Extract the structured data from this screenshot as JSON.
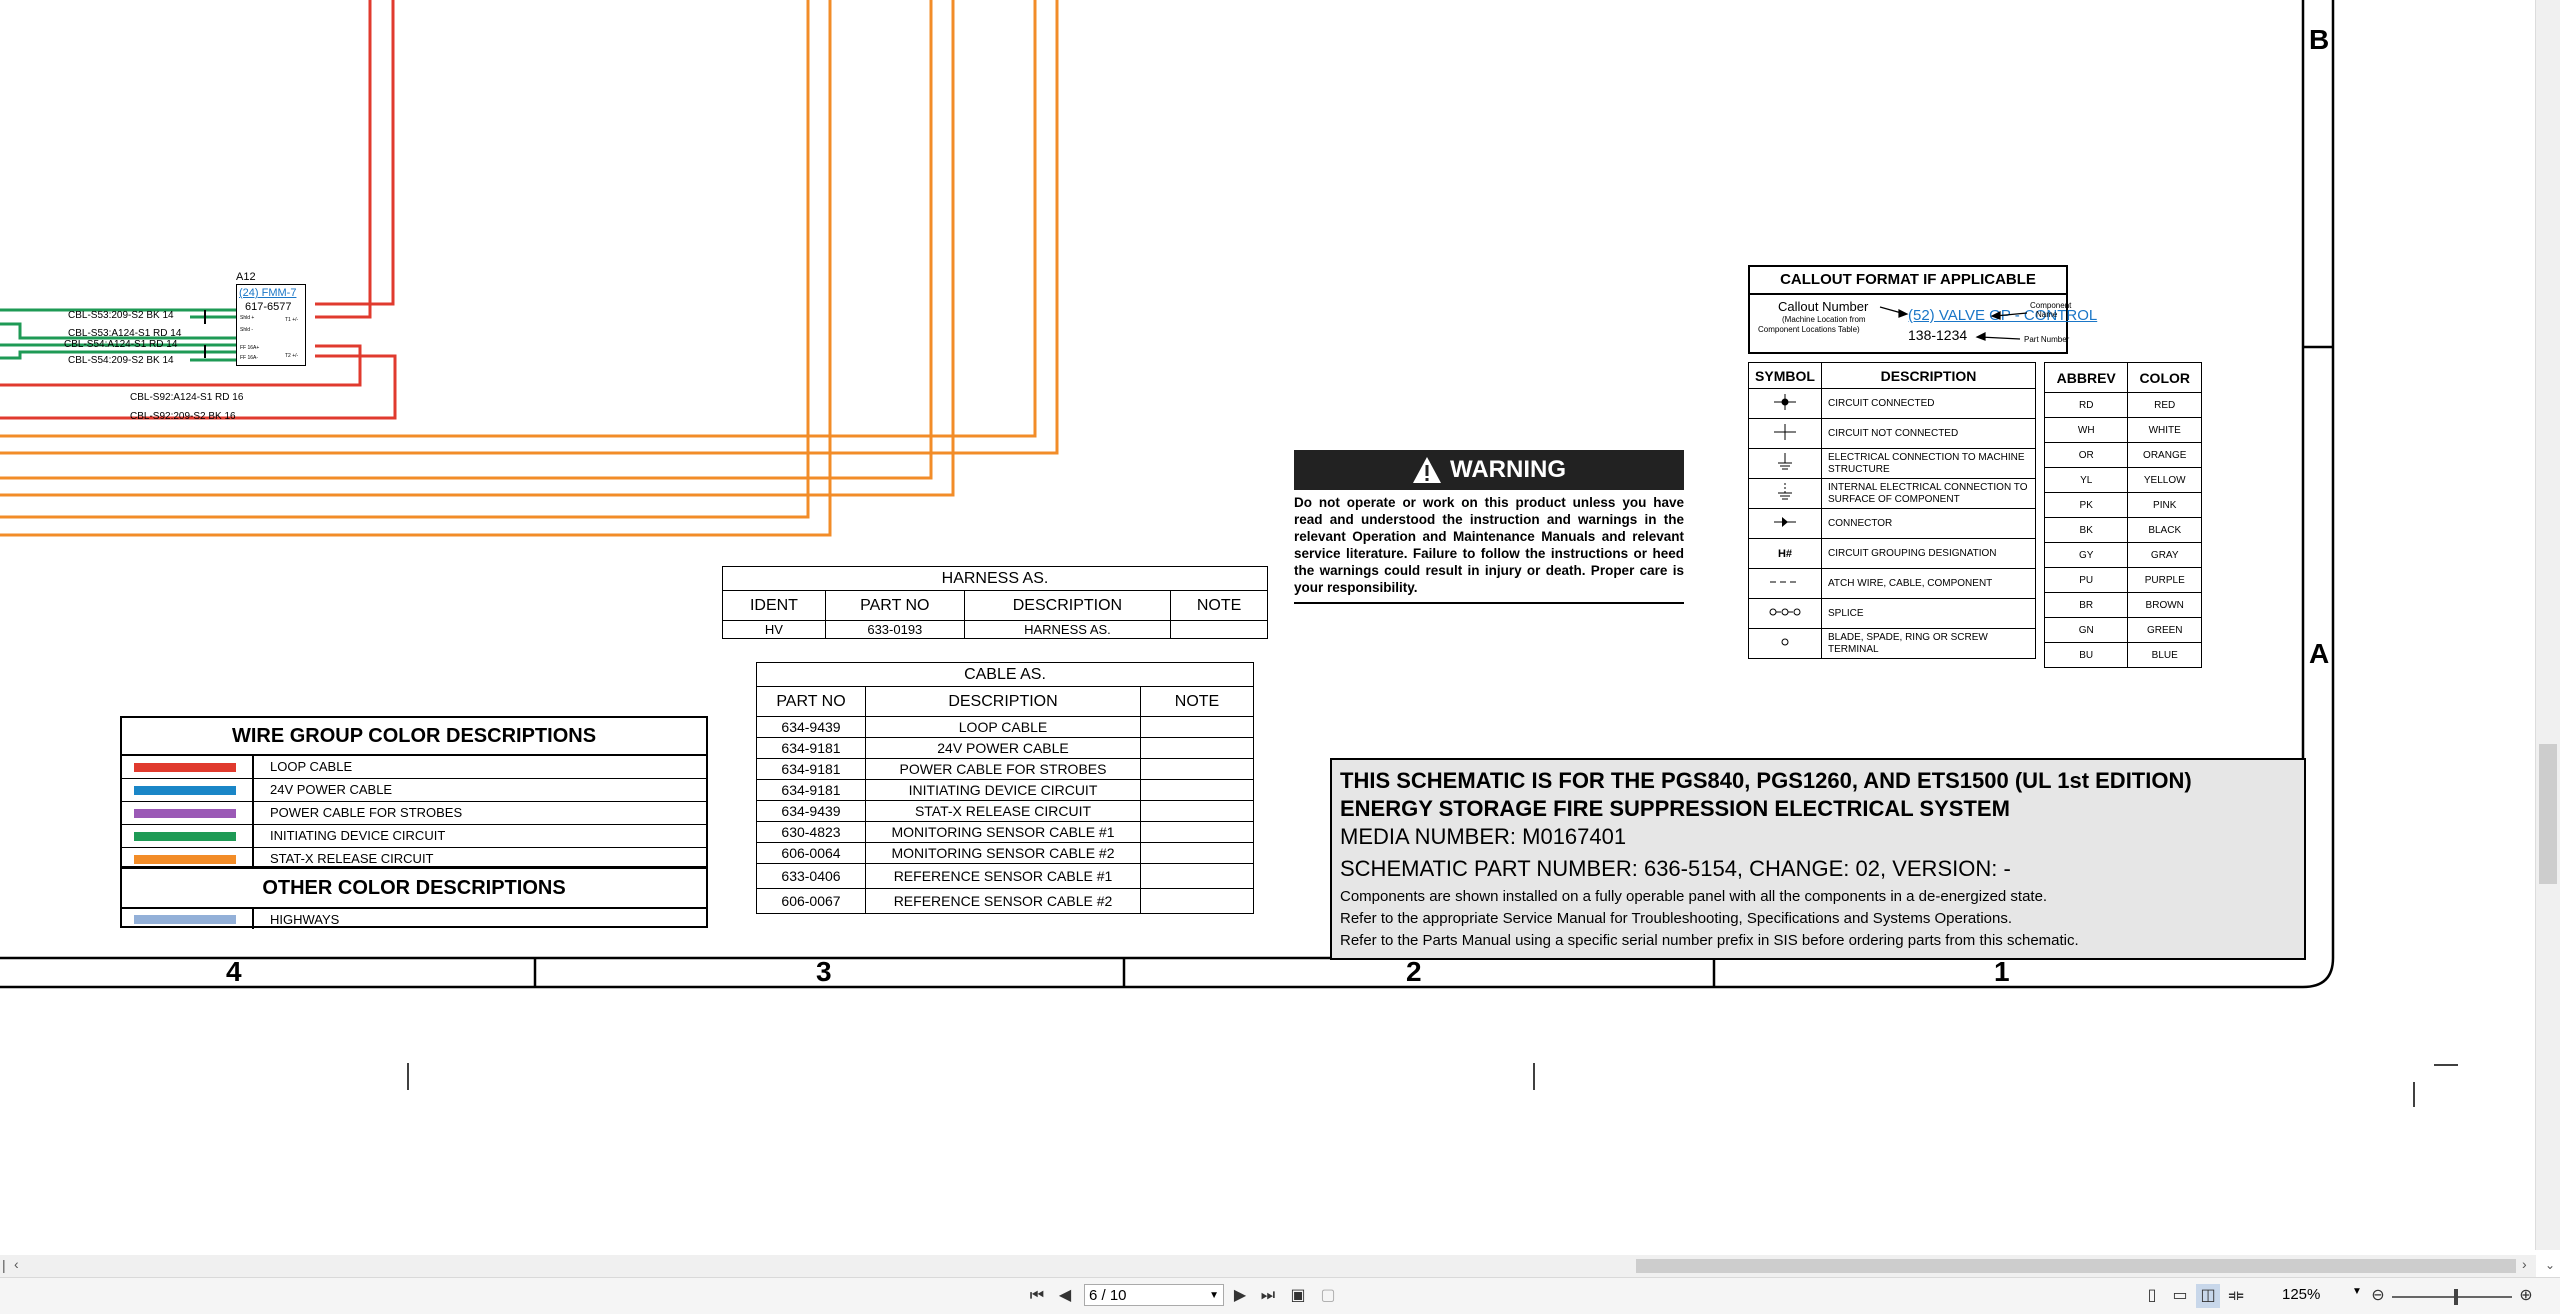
{
  "border": {
    "rows": [
      "B",
      "A"
    ],
    "columns": [
      "4",
      "3",
      "2",
      "1"
    ]
  },
  "component": {
    "ref": "A12",
    "link": "(24) FMM-7",
    "part": "617-6577",
    "pins_left": [
      "Shld +",
      "Shld -",
      "FF 16A+",
      "FF 16A-"
    ],
    "pins_right": [
      "T1 +/-",
      "T2 +/-"
    ]
  },
  "wires": [
    {
      "label": "CBL-S53:209-S2 BK 14",
      "color": "#1e9a55"
    },
    {
      "label": "CBL-S53:A124-S1 RD 14",
      "color": "#1e9a55"
    },
    {
      "label": "CBL-S54:A124-S1 RD 14",
      "color": "#1e9a55"
    },
    {
      "label": "CBL-S54:209-S2 BK 14",
      "color": "#1e9a55"
    },
    {
      "label": "CBL-S92:A124-S1 RD 16",
      "color": "#e03a2e"
    },
    {
      "label": "CBL-S92:209-S2 BK 16",
      "color": "#e03a2e"
    }
  ],
  "colors": {
    "loop": "#e03a2e",
    "power24": "#1a86c7",
    "strobe": "#9b59b6",
    "initiating": "#1e9a55",
    "statx": "#f28c28",
    "highways": "#93b0d8",
    "title_bg": "#e6e6e6"
  },
  "warning": {
    "title": "WARNING",
    "text": "Do not operate or work on this product unless you have read and understood the instruction and warnings in the relevant Operation and Maintenance Manuals and relevant service literature. Failure to follow the instructions or heed the warnings could result in injury or death. Proper care is your responsibility."
  },
  "callout": {
    "title": "CALLOUT FORMAT IF APPLICABLE",
    "callout_number": "Callout Number",
    "machine_location": "(Machine Location from",
    "component_table": "Component Locations Table)",
    "example": "(52) VALVE GP - CONTROL",
    "component_name_1": "Component",
    "component_name_2": "Name",
    "part_number_example": "138-1234",
    "part_number": "Part Number"
  },
  "symbols": {
    "headers": [
      "SYMBOL",
      "DESCRIPTION"
    ],
    "rows": [
      {
        "icon": "circuit-connected-icon",
        "desc": "CIRCUIT CONNECTED"
      },
      {
        "icon": "circuit-not-connected-icon",
        "desc": "CIRCUIT NOT CONNECTED"
      },
      {
        "icon": "ground-machine-icon",
        "desc": "ELECTRICAL CONNECTION TO MACHINE STRUCTURE"
      },
      {
        "icon": "ground-internal-icon",
        "desc": "INTERNAL ELECTRICAL CONNECTION TO SURFACE OF COMPONENT"
      },
      {
        "icon": "connector-icon",
        "desc": "CONNECTOR"
      },
      {
        "icon": "grouping-icon",
        "symbol": "H#",
        "desc": "CIRCUIT GROUPING DESIGNATION"
      },
      {
        "icon": "attach-wire-icon",
        "desc": "ATCH WIRE, CABLE, COMPONENT"
      },
      {
        "icon": "splice-icon",
        "desc": "SPLICE"
      },
      {
        "icon": "terminal-icon",
        "desc": "BLADE, SPADE, RING OR SCREW TERMINAL"
      }
    ]
  },
  "abbrev": {
    "headers": [
      "ABBREV",
      "COLOR"
    ],
    "rows": [
      [
        "RD",
        "RED"
      ],
      [
        "WH",
        "WHITE"
      ],
      [
        "OR",
        "ORANGE"
      ],
      [
        "YL",
        "YELLOW"
      ],
      [
        "PK",
        "PINK"
      ],
      [
        "BK",
        "BLACK"
      ],
      [
        "GY",
        "GRAY"
      ],
      [
        "PU",
        "PURPLE"
      ],
      [
        "BR",
        "BROWN"
      ],
      [
        "GN",
        "GREEN"
      ],
      [
        "BU",
        "BLUE"
      ]
    ]
  },
  "harness": {
    "title": "HARNESS AS.",
    "headers": [
      "IDENT",
      "PART NO",
      "DESCRIPTION",
      "NOTE"
    ],
    "rows": [
      [
        "HV",
        "633-0193",
        "HARNESS AS.",
        ""
      ]
    ]
  },
  "cable": {
    "title": "CABLE AS.",
    "headers": [
      "PART NO",
      "DESCRIPTION",
      "NOTE"
    ],
    "rows": [
      [
        "634-9439",
        "LOOP CABLE",
        ""
      ],
      [
        "634-9181",
        "24V POWER CABLE",
        ""
      ],
      [
        "634-9181",
        "POWER CABLE FOR STROBES",
        ""
      ],
      [
        "634-9181",
        "INITIATING DEVICE CIRCUIT",
        ""
      ],
      [
        "634-9439",
        "STAT-X RELEASE CIRCUIT",
        ""
      ],
      [
        "630-4823",
        "MONITORING SENSOR CABLE #1",
        ""
      ],
      [
        "606-0064",
        "MONITORING SENSOR CABLE #2",
        ""
      ],
      [
        "633-0406",
        "REFERENCE SENSOR CABLE #1",
        ""
      ],
      [
        "606-0067",
        "REFERENCE SENSOR CABLE #2",
        ""
      ]
    ]
  },
  "wire_group": {
    "title": "WIRE GROUP COLOR DESCRIPTIONS",
    "items": [
      "LOOP CABLE",
      "24V POWER CABLE",
      "POWER CABLE FOR STROBES",
      "INITIATING DEVICE CIRCUIT",
      "STAT-X RELEASE CIRCUIT"
    ],
    "other_title": "OTHER COLOR DESCRIPTIONS",
    "other_items": [
      "HIGHWAYS"
    ]
  },
  "title_block": {
    "line1": "THIS SCHEMATIC IS FOR THE PGS840, PGS1260, AND ETS1500 (UL 1st EDITION)",
    "line2": "ENERGY STORAGE FIRE SUPPRESSION ELECTRICAL SYSTEM",
    "media": "MEDIA NUMBER: M0167401",
    "part": "SCHEMATIC PART NUMBER: 636-5154, CHANGE: 02, VERSION: -",
    "note1": "Components are shown installed on a fully operable panel with all the components in a de-energized state.",
    "note2": "Refer to the appropriate Service Manual for Troubleshooting, Specifications and Systems Operations.",
    "note3": "Refer to the Parts Manual using a specific serial number prefix in SIS before ordering parts from this schematic."
  },
  "viewer": {
    "page_display": "6 / 10",
    "zoom": "125%"
  }
}
